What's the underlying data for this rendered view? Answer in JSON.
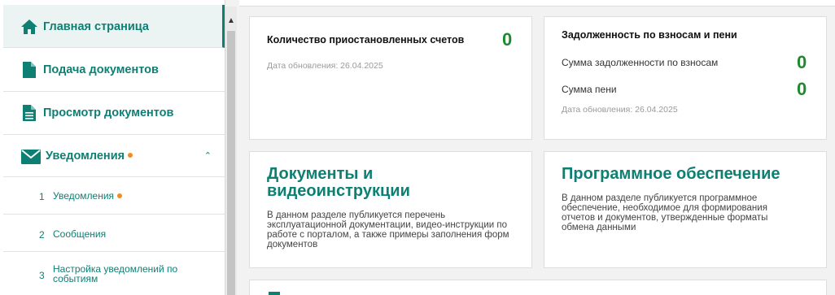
{
  "sidebar": {
    "items": [
      {
        "label": "Главная страница",
        "icon": "home-icon"
      },
      {
        "label": "Подача документов",
        "icon": "document-icon"
      },
      {
        "label": "Просмотр документов",
        "icon": "document-list-icon"
      },
      {
        "label": "Уведомления",
        "icon": "envelope-icon"
      }
    ],
    "subitems": [
      {
        "num": "1",
        "label": "Уведомления"
      },
      {
        "num": "2",
        "label": "Сообщения"
      },
      {
        "num": "3",
        "label": "Настройка уведомлений по событиям"
      }
    ]
  },
  "cards": {
    "suspended": {
      "title": "Количество приостановленных счетов",
      "value": "0",
      "updated": "Дата обновления: 26.04.2025"
    },
    "debt": {
      "title": "Задолженность по взносам и пени",
      "row1_label": "Сумма задолженности по взносам",
      "row1_value": "0",
      "row2_label": "Сумма пени",
      "row2_value": "0",
      "updated": "Дата обновления: 26.04.2025"
    },
    "docs": {
      "heading": "Документы и видеоинструкции",
      "desc": "В данном разделе публикуется перечень эксплуатационной документации, видео-инструкции по работе с порталом, а также примеры заполнения форм документов"
    },
    "software": {
      "heading": "Программное обеспечение",
      "desc": "В данном разделе публикуется программное обеспечение, необходимое для формирования отчетов и документов, утвержденные форматы обмена данными"
    }
  },
  "colors": {
    "accent": "#0e7f73",
    "value_green": "#1f8a2c",
    "notification_dot": "#f28c1e"
  }
}
